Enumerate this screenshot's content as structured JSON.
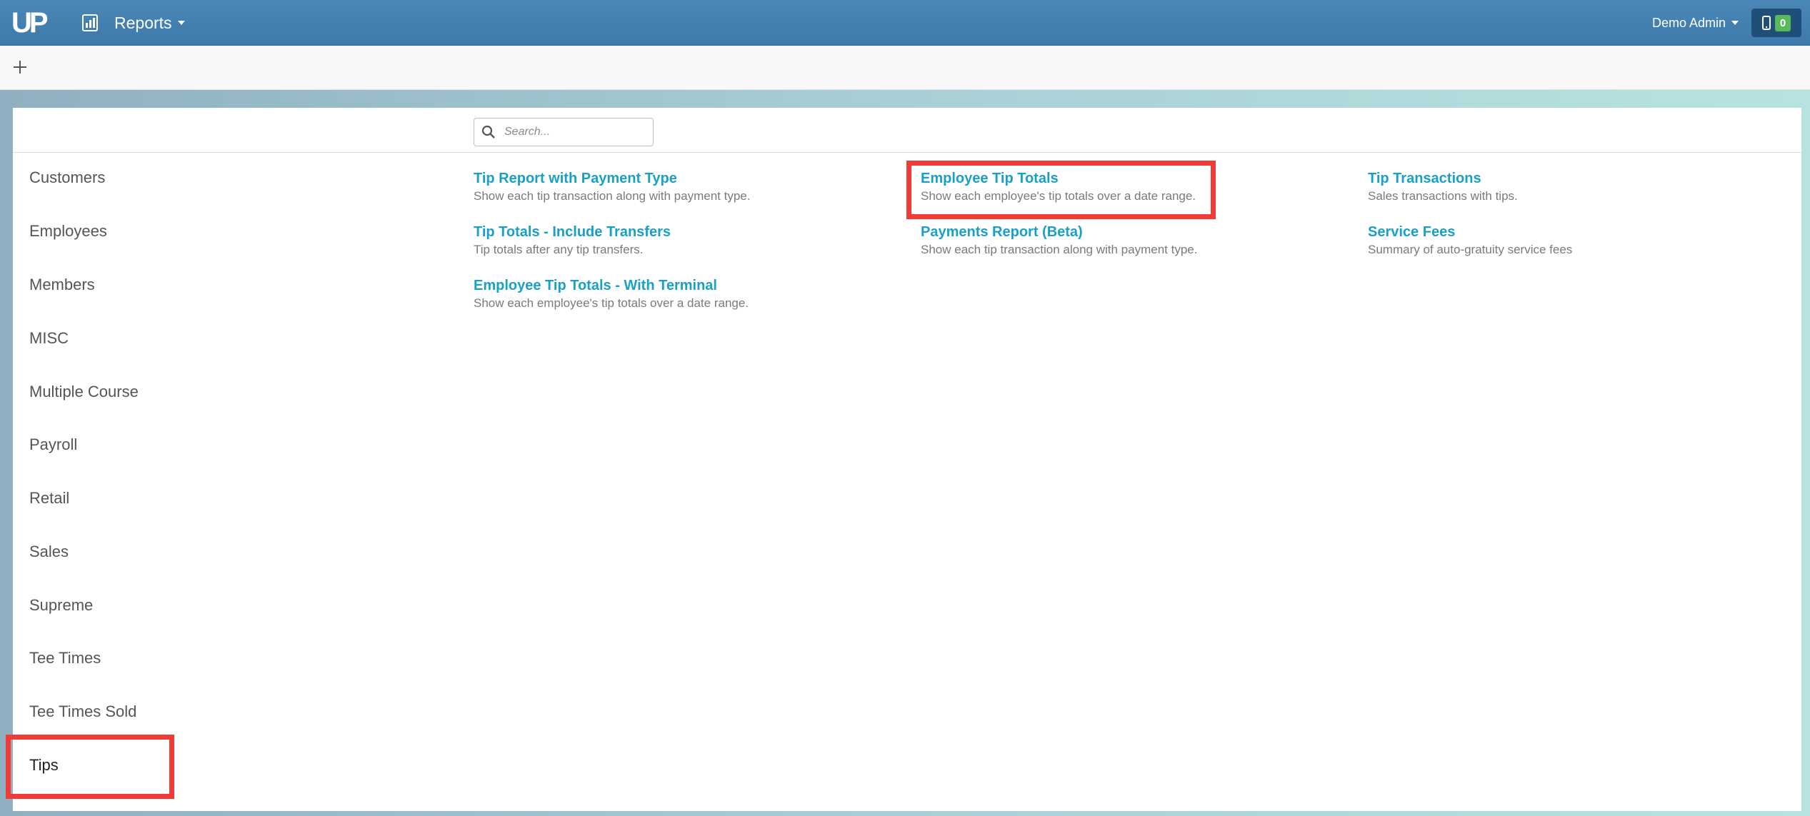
{
  "app": {
    "logo_text": "UP",
    "menu_label": "Reports",
    "user_label": "Demo Admin",
    "device_badge": "0"
  },
  "colors": {
    "topbar": "#4383b3",
    "link": "#1aa0c6",
    "highlight": "#f23b36",
    "badge": "#5cb85c"
  },
  "search": {
    "placeholder": "Search..."
  },
  "categories": [
    "Customers",
    "Employees",
    "Members",
    "MISC",
    "Multiple Course",
    "Payroll",
    "Retail",
    "Sales",
    "Supreme",
    "Tee Times",
    "Tee Times Sold",
    "Tips"
  ],
  "active_category": "Tips",
  "reports": [
    {
      "title": "Tip Report with Payment Type",
      "desc": "Show each tip transaction along with payment type."
    },
    {
      "title": "Employee Tip Totals",
      "desc": "Show each employee's tip totals over a date range."
    },
    {
      "title": "Tip Transactions",
      "desc": "Sales transactions with tips."
    },
    {
      "title": "Tip Totals - Include Transfers",
      "desc": "Tip totals after any tip transfers."
    },
    {
      "title": "Payments Report (Beta)",
      "desc": "Show each tip transaction along with payment type."
    },
    {
      "title": "Service Fees",
      "desc": "Summary of auto-gratuity service fees"
    },
    {
      "title": "Employee Tip Totals - With Terminal",
      "desc": "Show each employee's tip totals over a date range."
    }
  ]
}
